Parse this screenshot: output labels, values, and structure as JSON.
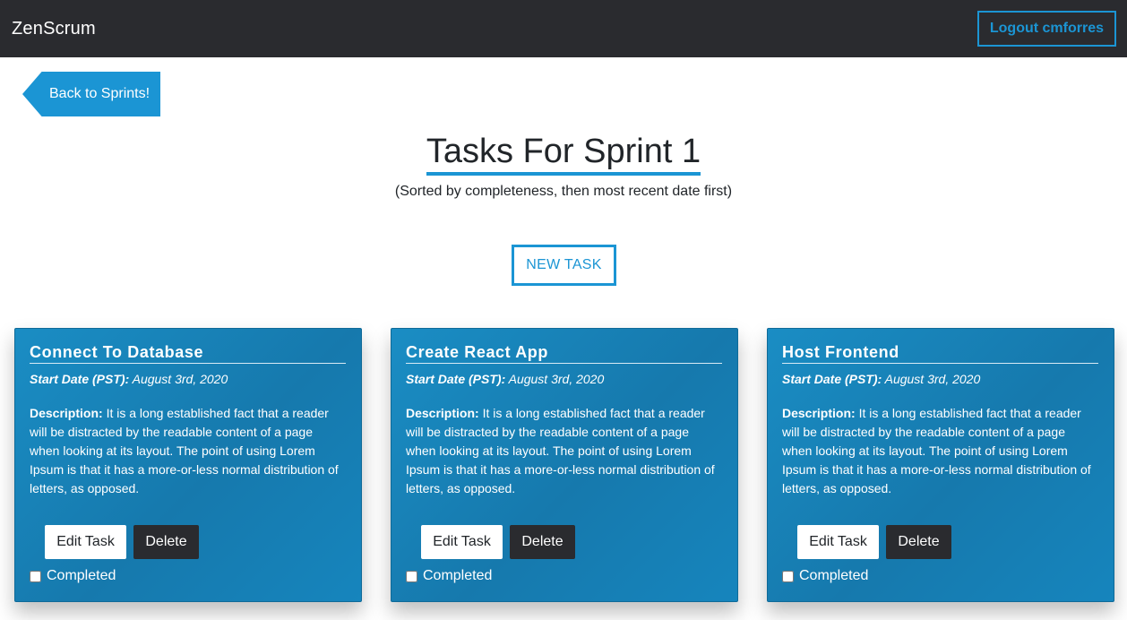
{
  "navbar": {
    "brand": "ZenScrum",
    "logout_label": "Logout cmforres"
  },
  "back_button_label": "Back to Sprints!",
  "page": {
    "title": "Tasks For Sprint 1",
    "subtitle": "(Sorted by completeness, then most recent date first)",
    "new_task_label": "NEW TASK"
  },
  "tasks": [
    {
      "title": "Connect To Database",
      "start_date_label": "Start Date (PST):",
      "start_date": "August 3rd, 2020",
      "description_label": "Description:",
      "description": "It is a long established fact that a reader will be distracted by the readable content of a page when looking at its layout. The point of using Lorem Ipsum is that it has a more-or-less normal distribution of letters, as opposed.",
      "edit_label": "Edit Task",
      "delete_label": "Delete",
      "completed_label": "Completed",
      "completed": false
    },
    {
      "title": "Create React App",
      "start_date_label": "Start Date (PST):",
      "start_date": "August 3rd, 2020",
      "description_label": "Description:",
      "description": "It is a long established fact that a reader will be distracted by the readable content of a page when looking at its layout. The point of using Lorem Ipsum is that it has a more-or-less normal distribution of letters, as opposed.",
      "edit_label": "Edit Task",
      "delete_label": "Delete",
      "completed_label": "Completed",
      "completed": false
    },
    {
      "title": "Host Frontend",
      "start_date_label": "Start Date (PST):",
      "start_date": "August 3rd, 2020",
      "description_label": "Description:",
      "description": "It is a long established fact that a reader will be distracted by the readable content of a page when looking at its layout. The point of using Lorem Ipsum is that it has a more-or-less normal distribution of letters, as opposed.",
      "edit_label": "Edit Task",
      "delete_label": "Delete",
      "completed_label": "Completed",
      "completed": false
    }
  ],
  "colors": {
    "navbar_bg": "#2a2b2f",
    "accent": "#1b95d4",
    "card_bg": "#1679ad"
  }
}
